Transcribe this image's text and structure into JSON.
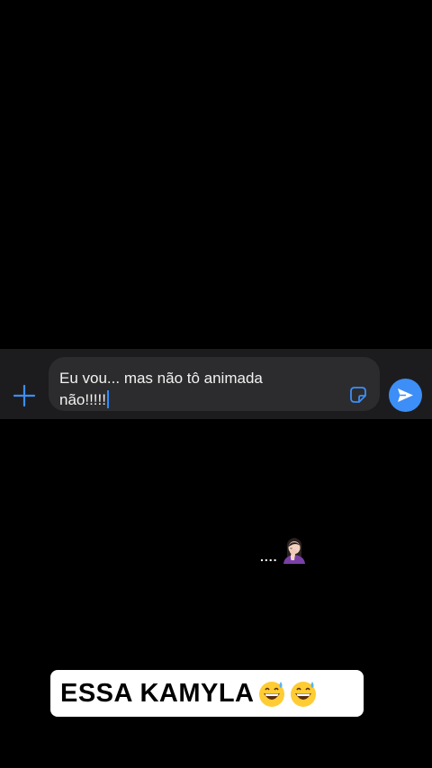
{
  "compose": {
    "text": "Eu vou... mas não tô animada\nnão!!!!!",
    "plus_icon": "plus-icon",
    "sticker_icon": "sticker-icon",
    "send_icon": "send-icon",
    "accent_color": "#3d8ef7"
  },
  "overlay": {
    "ellipsis": "....",
    "emoji_icon": "woman-facepalming-emoji"
  },
  "caption": {
    "text": "ESSA KAMYLA",
    "emoji_icon": "grinning-sweat-emoji",
    "emoji_count": 2
  }
}
